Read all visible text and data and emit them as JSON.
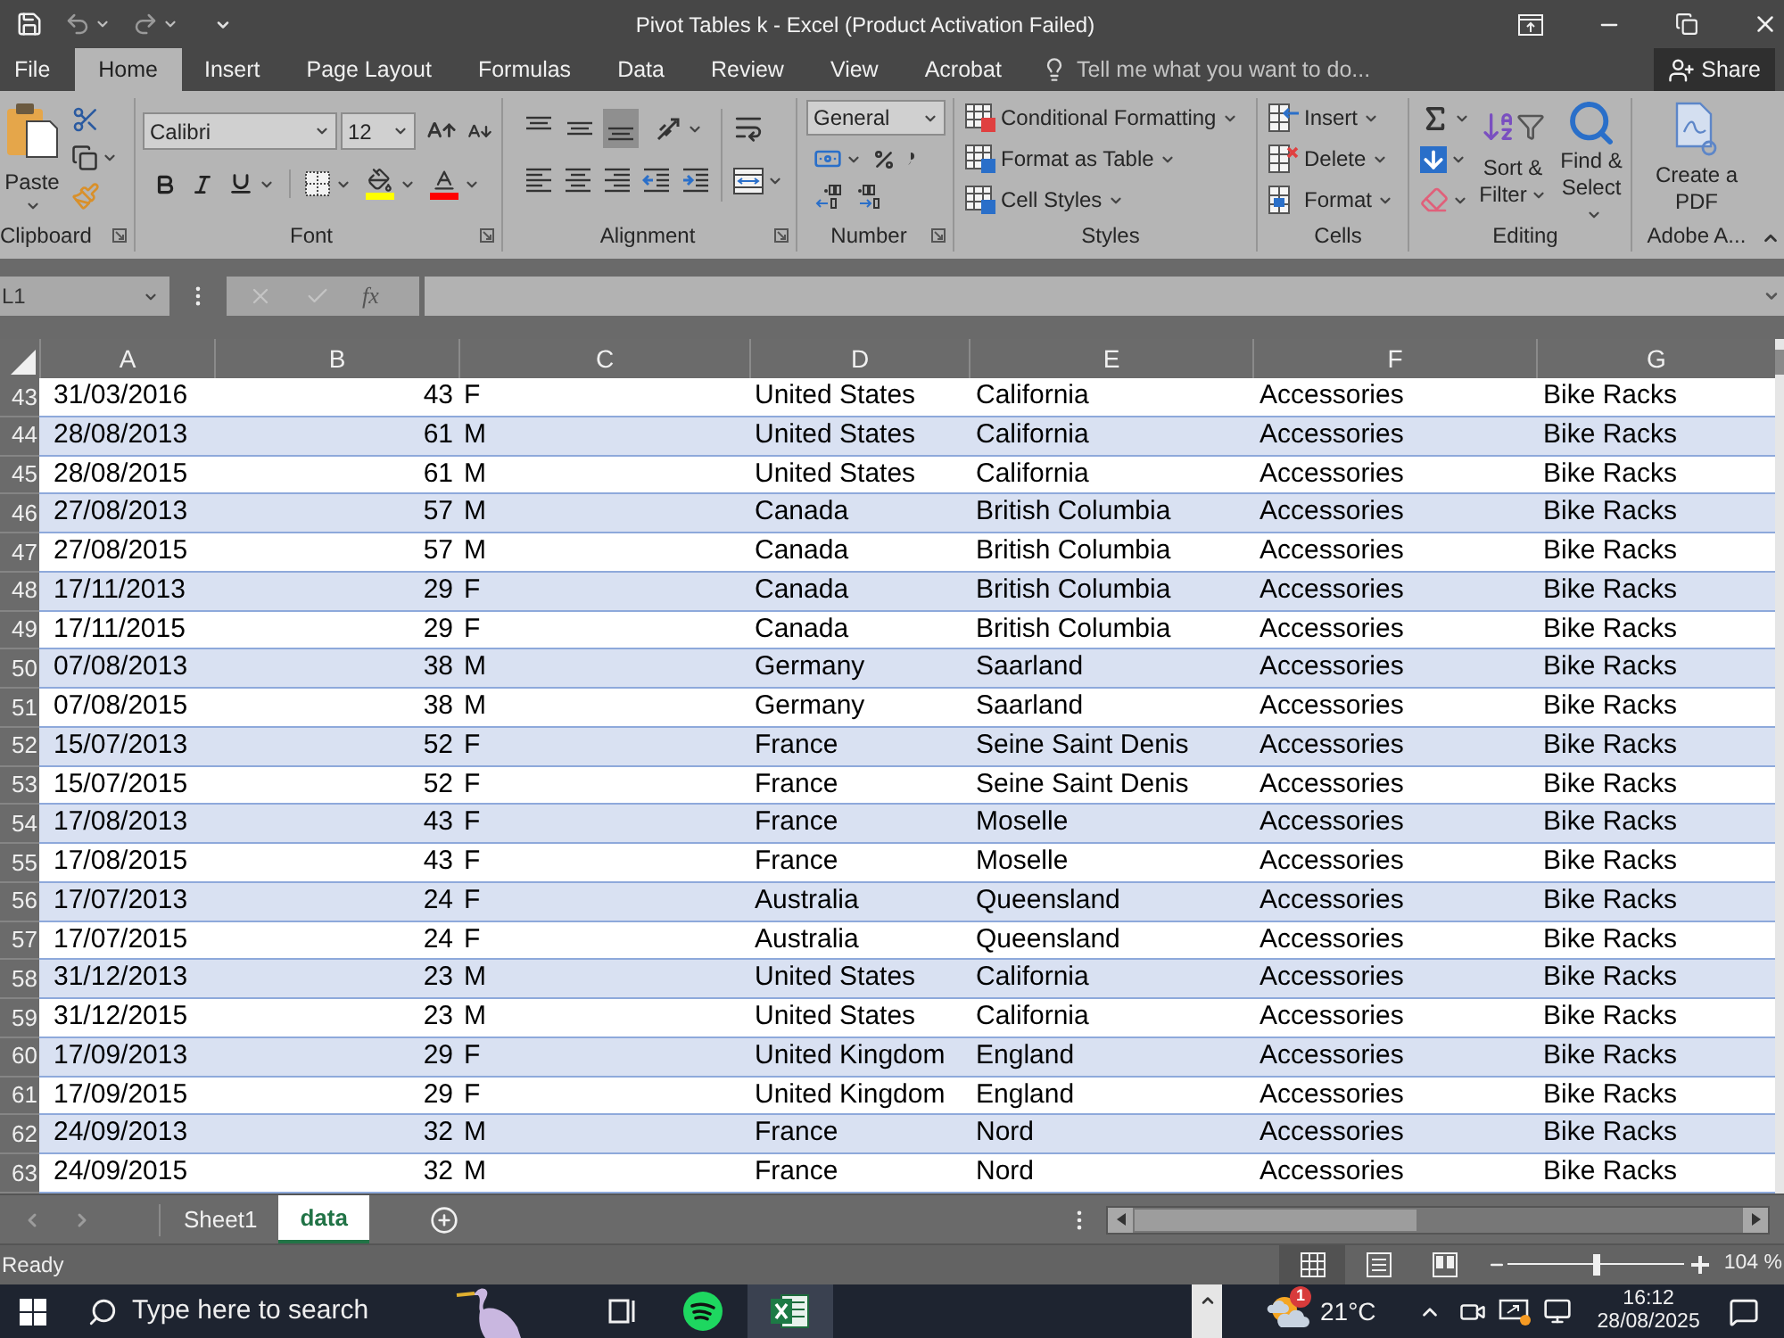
{
  "title_bar": {
    "quick_access": [
      {
        "kind": "save",
        "disabled": false
      },
      {
        "kind": "undo",
        "disabled": true
      },
      {
        "kind": "redo",
        "disabled": true
      }
    ],
    "title": "Pivot Tables k - Excel (Product Activation Failed)"
  },
  "ribbon_tabs": [
    {
      "label": "File",
      "selected": false
    },
    {
      "label": "Home",
      "selected": true
    },
    {
      "label": "Insert",
      "selected": false
    },
    {
      "label": "Page Layout",
      "selected": false
    },
    {
      "label": "Formulas",
      "selected": false
    },
    {
      "label": "Data",
      "selected": false
    },
    {
      "label": "Review",
      "selected": false
    },
    {
      "label": "View",
      "selected": false
    },
    {
      "label": "Acrobat",
      "selected": false
    }
  ],
  "tell_me": {
    "placeholder": "Tell me what you want to do..."
  },
  "share_button": "Share",
  "ribbon": {
    "clipboard": {
      "label": "Clipboard",
      "paste": "Paste"
    },
    "font": {
      "label": "Font",
      "font_name": "Calibri",
      "font_size": "12"
    },
    "alignment": {
      "label": "Alignment",
      "vertical_align": [
        {
          "kind": "top",
          "selected": false
        },
        {
          "kind": "middle",
          "selected": false
        },
        {
          "kind": "bottom",
          "selected": true
        }
      ]
    },
    "number": {
      "label": "Number",
      "format": "General"
    },
    "styles": {
      "label": "Styles",
      "commands": [
        "Conditional Formatting",
        "Format as Table",
        "Cell Styles"
      ]
    },
    "cells": {
      "label": "Cells",
      "commands": [
        "Insert",
        "Delete",
        "Format"
      ]
    },
    "editing": {
      "label": "Editing",
      "commands": [
        "Sort & Filter",
        "Find & Select"
      ]
    },
    "adobe": {
      "label": "Adobe A...",
      "commands": [
        "Create a PDF"
      ]
    }
  },
  "formula_bar": {
    "name_box": "L1",
    "buttons": [
      {
        "kind": "cancel",
        "disabled": true
      },
      {
        "kind": "enter",
        "disabled": true
      }
    ],
    "function_button": "fx"
  },
  "sheet": {
    "columns": [
      "A",
      "B",
      "C",
      "D",
      "E",
      "F",
      "G"
    ],
    "rows": [
      {
        "number": "43",
        "cells": [
          "31/03/2016",
          "43",
          "F",
          "United States",
          "California",
          "Accessories",
          "Bike Racks"
        ]
      },
      {
        "number": "44",
        "cells": [
          "28/08/2013",
          "61",
          "M",
          "United States",
          "California",
          "Accessories",
          "Bike Racks"
        ]
      },
      {
        "number": "45",
        "cells": [
          "28/08/2015",
          "61",
          "M",
          "United States",
          "California",
          "Accessories",
          "Bike Racks"
        ]
      },
      {
        "number": "46",
        "cells": [
          "27/08/2013",
          "57",
          "M",
          "Canada",
          "British Columbia",
          "Accessories",
          "Bike Racks"
        ]
      },
      {
        "number": "47",
        "cells": [
          "27/08/2015",
          "57",
          "M",
          "Canada",
          "British Columbia",
          "Accessories",
          "Bike Racks"
        ]
      },
      {
        "number": "48",
        "cells": [
          "17/11/2013",
          "29",
          "F",
          "Canada",
          "British Columbia",
          "Accessories",
          "Bike Racks"
        ]
      },
      {
        "number": "49",
        "cells": [
          "17/11/2015",
          "29",
          "F",
          "Canada",
          "British Columbia",
          "Accessories",
          "Bike Racks"
        ]
      },
      {
        "number": "50",
        "cells": [
          "07/08/2013",
          "38",
          "M",
          "Germany",
          "Saarland",
          "Accessories",
          "Bike Racks"
        ]
      },
      {
        "number": "51",
        "cells": [
          "07/08/2015",
          "38",
          "M",
          "Germany",
          "Saarland",
          "Accessories",
          "Bike Racks"
        ]
      },
      {
        "number": "52",
        "cells": [
          "15/07/2013",
          "52",
          "F",
          "France",
          "Seine Saint Denis",
          "Accessories",
          "Bike Racks"
        ]
      },
      {
        "number": "53",
        "cells": [
          "15/07/2015",
          "52",
          "F",
          "France",
          "Seine Saint Denis",
          "Accessories",
          "Bike Racks"
        ]
      },
      {
        "number": "54",
        "cells": [
          "17/08/2013",
          "43",
          "F",
          "France",
          "Moselle",
          "Accessories",
          "Bike Racks"
        ]
      },
      {
        "number": "55",
        "cells": [
          "17/08/2015",
          "43",
          "F",
          "France",
          "Moselle",
          "Accessories",
          "Bike Racks"
        ]
      },
      {
        "number": "56",
        "cells": [
          "17/07/2013",
          "24",
          "F",
          "Australia",
          "Queensland",
          "Accessories",
          "Bike Racks"
        ]
      },
      {
        "number": "57",
        "cells": [
          "17/07/2015",
          "24",
          "F",
          "Australia",
          "Queensland",
          "Accessories",
          "Bike Racks"
        ]
      },
      {
        "number": "58",
        "cells": [
          "31/12/2013",
          "23",
          "M",
          "United States",
          "California",
          "Accessories",
          "Bike Racks"
        ]
      },
      {
        "number": "59",
        "cells": [
          "31/12/2015",
          "23",
          "M",
          "United States",
          "California",
          "Accessories",
          "Bike Racks"
        ]
      },
      {
        "number": "60",
        "cells": [
          "17/09/2013",
          "29",
          "F",
          "United Kingdom",
          "England",
          "Accessories",
          "Bike Racks"
        ]
      },
      {
        "number": "61",
        "cells": [
          "17/09/2015",
          "29",
          "F",
          "United Kingdom",
          "England",
          "Accessories",
          "Bike Racks"
        ]
      },
      {
        "number": "62",
        "cells": [
          "24/09/2013",
          "32",
          "M",
          "France",
          "Nord",
          "Accessories",
          "Bike Racks"
        ]
      },
      {
        "number": "63",
        "cells": [
          "24/09/2015",
          "32",
          "M",
          "France",
          "Nord",
          "Accessories",
          "Bike Racks"
        ]
      }
    ]
  },
  "sheet_nav": [
    {
      "kind": "previous",
      "disabled": true
    },
    {
      "kind": "next",
      "disabled": true
    }
  ],
  "sheet_tabs": [
    {
      "label": "Sheet1",
      "selected": false
    },
    {
      "label": "data",
      "selected": true
    }
  ],
  "status_bar": {
    "status": "Ready",
    "views": [
      {
        "kind": "normal",
        "selected": true
      },
      {
        "kind": "page_layout",
        "selected": false
      },
      {
        "kind": "page_break",
        "selected": false
      }
    ],
    "zoom": {
      "level": 0.5,
      "reading": "104 %"
    }
  },
  "taskbar": {
    "search": {
      "placeholder": "Type here to search"
    },
    "weather": {
      "badge": "1",
      "temperature": "21°C"
    },
    "clock": {
      "time": "16:12",
      "date": "28/08/2025"
    }
  }
}
